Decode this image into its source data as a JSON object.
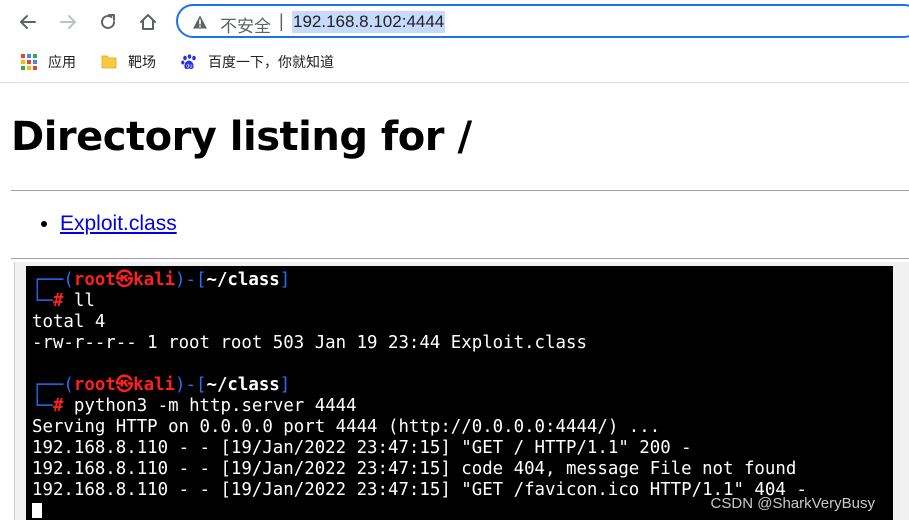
{
  "browser": {
    "security_label": "不安全",
    "separator": "|",
    "url": "192.168.8.102:4444",
    "accent_color": "#1a73e8"
  },
  "bookmarks": [
    {
      "label": "应用",
      "icon": "apps-grid-icon"
    },
    {
      "label": "靶场",
      "icon": "folder-icon"
    },
    {
      "label": "百度一下，你就知道",
      "icon": "baidu-paw-icon"
    }
  ],
  "page": {
    "title": "Directory listing for /",
    "files": [
      "Exploit.class"
    ]
  },
  "terminal": {
    "prompt_open": "┌──(",
    "prompt_user": "root㉿kali",
    "prompt_mid": ")-[",
    "prompt_dir": "~/class",
    "prompt_close": "]",
    "prompt_hash_prefix": "└─",
    "prompt_hash": "#",
    "cmd1": "ll",
    "out1": "total 4",
    "out2": "-rw-r--r-- 1 root root 503 Jan 19 23:44 Exploit.class",
    "cmd2": "python3 -m http.server 4444",
    "out3": "Serving HTTP on 0.0.0.0 port 4444 (http://0.0.0.0:4444/) ...",
    "out4": "192.168.8.110 - - [19/Jan/2022 23:47:15] \"GET / HTTP/1.1\" 200 -",
    "out5": "192.168.8.110 - - [19/Jan/2022 23:47:15] code 404, message File not found",
    "out6": "192.168.8.110 - - [19/Jan/2022 23:47:15] \"GET /favicon.ico HTTP/1.1\" 404 -",
    "watermark": "CSDN @SharkVeryBusy"
  }
}
